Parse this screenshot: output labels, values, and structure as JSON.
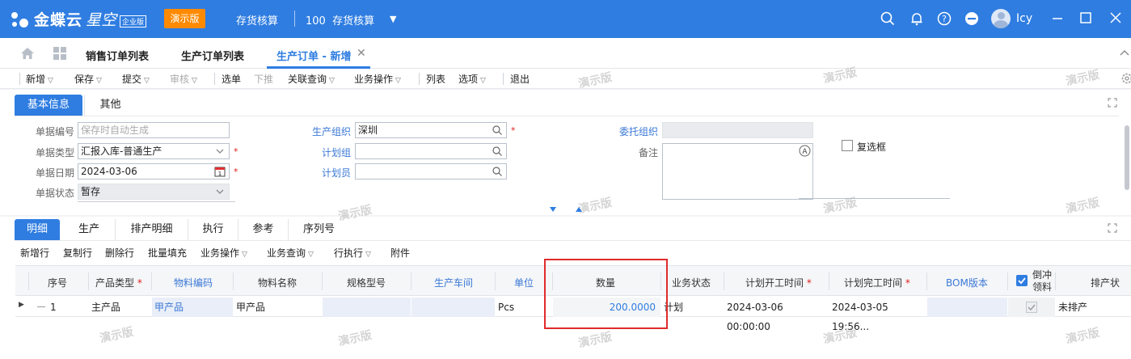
{
  "app": {
    "brand": "金蝶云",
    "brand_sub": "星空",
    "edition": "企业版",
    "demo_badge": "演示版",
    "module": "存货核算",
    "org_code": "100",
    "org_name": "存货核算",
    "user": "Icy"
  },
  "tabs": [
    {
      "label": "销售订单列表"
    },
    {
      "label": "生产订单列表"
    },
    {
      "label": "生产订单 - 新增"
    }
  ],
  "toolbar": {
    "new": "新增",
    "save": "保存",
    "submit": "提交",
    "audit": "审核",
    "select": "选单",
    "push": "下推",
    "linked_query": "关联查询",
    "business_op": "业务操作",
    "list": "列表",
    "options": "选项",
    "exit": "退出"
  },
  "header_tabs": {
    "basic": "基本信息",
    "other": "其他"
  },
  "form": {
    "bill_no_label": "单据编号",
    "bill_no_placeholder": "保存时自动生成",
    "bill_type_label": "单据类型",
    "bill_type_value": "汇报入库-普通生产",
    "bill_date_label": "单据日期",
    "bill_date_value": "2024-03-06",
    "bill_status_label": "单据状态",
    "bill_status_value": "暂存",
    "prod_org_label": "生产组织",
    "prod_org_value": "深圳",
    "plan_group_label": "计划组",
    "planner_label": "计划员",
    "entrust_org_label": "委托组织",
    "remark_label": "备注",
    "checkbox_label": "复选框"
  },
  "detail_tabs": {
    "detail": "明细",
    "production": "生产",
    "schedule_detail": "排产明细",
    "execution": "执行",
    "reference": "参考",
    "serial_no": "序列号"
  },
  "detail_toolbar": {
    "add_row": "新增行",
    "copy_row": "复制行",
    "delete_row": "删除行",
    "batch_fill": "批量填充",
    "business_op": "业务操作",
    "business_query": "业务查询",
    "row_exec": "行执行",
    "attachment": "附件"
  },
  "grid": {
    "columns": {
      "seq": "序号",
      "product_type": "产品类型",
      "material_code": "物料编码",
      "material_name": "物料名称",
      "spec": "规格型号",
      "workshop": "生产车间",
      "unit": "单位",
      "qty": "数量",
      "biz_status": "业务状态",
      "plan_start": "计划开工时间",
      "plan_finish": "计划完工时间",
      "bom": "BOM版本",
      "backflush_1": "倒冲",
      "backflush_2": "领料",
      "schedule": "排产状"
    },
    "rows": [
      {
        "seq": "1",
        "product_type": "主产品",
        "material_code": "甲产品",
        "material_name": "甲产品",
        "spec": "",
        "workshop": "",
        "unit": "Pcs",
        "qty": "200.0000",
        "biz_status": "计划",
        "plan_start": "2024-03-06 00:00:00",
        "plan_finish": "2024-03-05 19:56...",
        "bom": "",
        "backflush": true,
        "schedule": "未排产"
      }
    ]
  },
  "watermark": "演示版",
  "colors": {
    "primary": "#2f7de1",
    "demo_badge": "#ff8a00",
    "required": "#e02020",
    "highlight": "#e02b2b"
  }
}
